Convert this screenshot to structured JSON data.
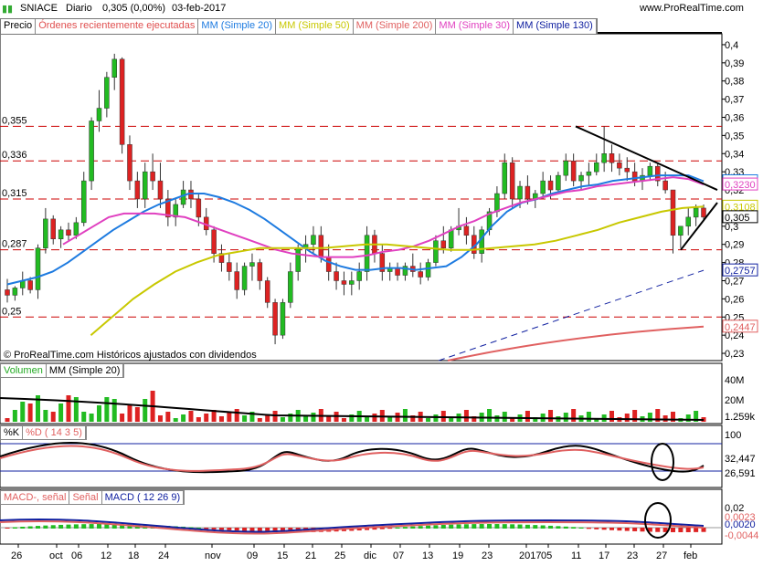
{
  "header": {
    "symbol": "SNIACE",
    "period": "Diario",
    "last": "0,305 (0,00%)",
    "date": "03-feb-2017",
    "site": "www.ProRealTime.com"
  },
  "legend": [
    {
      "label": "Precio",
      "color": "#000000"
    },
    {
      "label": "Órdenes recientemente ejecutadas",
      "color": "#e05050"
    },
    {
      "label": "MM (Simple 20)",
      "color": "#1e7be0"
    },
    {
      "label": "MM (Simple 50)",
      "color": "#c8c800"
    },
    {
      "label": "MM (Simple 200)",
      "color": "#e06060"
    },
    {
      "label": "MM (Simple 30)",
      "color": "#e040c0"
    },
    {
      "label": "MM (Simple 130)",
      "color": "#1020a0"
    }
  ],
  "copyright": "© ProRealTime.com  Históricos ajustados con dividendos",
  "volume_legend": [
    "Volumen",
    "MM (Simple 20)"
  ],
  "stoch_legend": [
    "%K",
    "%D ( 14 3 5)"
  ],
  "macd_legend": [
    "MACD-, señal",
    "Señal",
    "MACD ( 12 26 9)"
  ],
  "colors": {
    "up": "#22bb22",
    "down": "#dd2222",
    "ma20": "#1e7be0",
    "ma50": "#c8c800",
    "ma200": "#e06060",
    "ma30": "#e040c0",
    "ma130": "#1020a0"
  },
  "chart_data": {
    "type": "candlestick",
    "y_ticks": [
      "0,4",
      "0,39",
      "0,38",
      "0,37",
      "0,36",
      "0,35",
      "0,34",
      "0,33",
      "0,32",
      "0,31",
      "0,3",
      "0,29",
      "0,28",
      "0,27",
      "0,26",
      "0,25",
      "0,24",
      "0,23"
    ],
    "ylim": [
      0.226,
      0.406
    ],
    "levels": [
      {
        "label": "0,355",
        "value": 0.355
      },
      {
        "label": "0,336",
        "value": 0.336
      },
      {
        "label": "0,315",
        "value": 0.315
      },
      {
        "label": "0,287",
        "value": 0.287
      },
      {
        "label": "0,25",
        "value": 0.25
      }
    ],
    "price_boxes": [
      {
        "label": "0,3248",
        "value": 0.3248,
        "color": "#1e7be0"
      },
      {
        "label": "0,3230",
        "value": 0.323,
        "color": "#e040c0"
      },
      {
        "label": "0,3108",
        "value": 0.3108,
        "color": "#c8c800"
      },
      {
        "label": "0,305",
        "value": 0.305,
        "color": "#000000"
      },
      {
        "label": "0,2757",
        "value": 0.2757,
        "color": "#1020a0"
      },
      {
        "label": "0,2447",
        "value": 0.2447,
        "color": "#e06060"
      }
    ],
    "x_ticks": [
      "26",
      "oct",
      "06",
      "12",
      "18",
      "24",
      "nov",
      "09",
      "15",
      "21",
      "25",
      "dic",
      "07",
      "13",
      "19",
      "23",
      "2017",
      "05",
      "11",
      "17",
      "23",
      "27",
      "feb"
    ],
    "candles": [
      [
        0.265,
        0.271,
        0.258,
        0.262
      ],
      [
        0.262,
        0.267,
        0.259,
        0.266
      ],
      [
        0.266,
        0.275,
        0.262,
        0.27
      ],
      [
        0.27,
        0.272,
        0.263,
        0.265
      ],
      [
        0.265,
        0.29,
        0.26,
        0.288
      ],
      [
        0.288,
        0.31,
        0.285,
        0.304
      ],
      [
        0.304,
        0.306,
        0.29,
        0.293
      ],
      [
        0.293,
        0.3,
        0.288,
        0.298
      ],
      [
        0.298,
        0.302,
        0.292,
        0.295
      ],
      [
        0.295,
        0.305,
        0.293,
        0.302
      ],
      [
        0.302,
        0.33,
        0.3,
        0.325
      ],
      [
        0.325,
        0.36,
        0.32,
        0.358
      ],
      [
        0.358,
        0.375,
        0.352,
        0.365
      ],
      [
        0.365,
        0.385,
        0.36,
        0.382
      ],
      [
        0.382,
        0.395,
        0.375,
        0.392
      ],
      [
        0.392,
        0.393,
        0.34,
        0.345
      ],
      [
        0.345,
        0.35,
        0.32,
        0.325
      ],
      [
        0.325,
        0.33,
        0.31,
        0.315
      ],
      [
        0.315,
        0.335,
        0.31,
        0.33
      ],
      [
        0.33,
        0.34,
        0.32,
        0.325
      ],
      [
        0.325,
        0.335,
        0.31,
        0.315
      ],
      [
        0.315,
        0.32,
        0.3,
        0.305
      ],
      [
        0.305,
        0.315,
        0.3,
        0.312
      ],
      [
        0.312,
        0.325,
        0.31,
        0.32
      ],
      [
        0.32,
        0.325,
        0.31,
        0.315
      ],
      [
        0.315,
        0.318,
        0.3,
        0.305
      ],
      [
        0.305,
        0.31,
        0.295,
        0.298
      ],
      [
        0.298,
        0.3,
        0.28,
        0.285
      ],
      [
        0.285,
        0.29,
        0.275,
        0.28
      ],
      [
        0.28,
        0.285,
        0.27,
        0.275
      ],
      [
        0.275,
        0.28,
        0.26,
        0.265
      ],
      [
        0.265,
        0.28,
        0.262,
        0.278
      ],
      [
        0.278,
        0.285,
        0.27,
        0.28
      ],
      [
        0.28,
        0.282,
        0.265,
        0.27
      ],
      [
        0.27,
        0.272,
        0.255,
        0.258
      ],
      [
        0.258,
        0.26,
        0.235,
        0.24
      ],
      [
        0.24,
        0.26,
        0.238,
        0.258
      ],
      [
        0.258,
        0.28,
        0.255,
        0.275
      ],
      [
        0.275,
        0.29,
        0.27,
        0.288
      ],
      [
        0.288,
        0.295,
        0.28,
        0.29
      ],
      [
        0.29,
        0.3,
        0.285,
        0.295
      ],
      [
        0.295,
        0.3,
        0.28,
        0.283
      ],
      [
        0.283,
        0.29,
        0.27,
        0.275
      ],
      [
        0.275,
        0.28,
        0.265,
        0.27
      ],
      [
        0.27,
        0.275,
        0.262,
        0.268
      ],
      [
        0.268,
        0.275,
        0.262,
        0.27
      ],
      [
        0.27,
        0.28,
        0.265,
        0.275
      ],
      [
        0.275,
        0.3,
        0.27,
        0.295
      ],
      [
        0.295,
        0.298,
        0.28,
        0.285
      ],
      [
        0.285,
        0.29,
        0.27,
        0.275
      ],
      [
        0.275,
        0.28,
        0.27,
        0.277
      ],
      [
        0.277,
        0.28,
        0.27,
        0.273
      ],
      [
        0.273,
        0.28,
        0.27,
        0.278
      ],
      [
        0.278,
        0.285,
        0.272,
        0.275
      ],
      [
        0.275,
        0.28,
        0.268,
        0.272
      ],
      [
        0.272,
        0.282,
        0.27,
        0.28
      ],
      [
        0.28,
        0.295,
        0.278,
        0.292
      ],
      [
        0.292,
        0.3,
        0.285,
        0.288
      ],
      [
        0.288,
        0.3,
        0.286,
        0.298
      ],
      [
        0.298,
        0.31,
        0.295,
        0.3
      ],
      [
        0.3,
        0.305,
        0.29,
        0.295
      ],
      [
        0.295,
        0.3,
        0.282,
        0.285
      ],
      [
        0.285,
        0.3,
        0.28,
        0.298
      ],
      [
        0.298,
        0.31,
        0.295,
        0.308
      ],
      [
        0.308,
        0.322,
        0.305,
        0.318
      ],
      [
        0.318,
        0.34,
        0.315,
        0.335
      ],
      [
        0.335,
        0.338,
        0.31,
        0.315
      ],
      [
        0.315,
        0.325,
        0.31,
        0.322
      ],
      [
        0.322,
        0.328,
        0.312,
        0.315
      ],
      [
        0.315,
        0.32,
        0.31,
        0.318
      ],
      [
        0.318,
        0.33,
        0.315,
        0.325
      ],
      [
        0.325,
        0.328,
        0.315,
        0.32
      ],
      [
        0.32,
        0.33,
        0.318,
        0.328
      ],
      [
        0.328,
        0.34,
        0.325,
        0.336
      ],
      [
        0.336,
        0.34,
        0.322,
        0.325
      ],
      [
        0.325,
        0.33,
        0.32,
        0.328
      ],
      [
        0.328,
        0.335,
        0.322,
        0.33
      ],
      [
        0.33,
        0.34,
        0.328,
        0.335
      ],
      [
        0.335,
        0.355,
        0.33,
        0.34
      ],
      [
        0.34,
        0.345,
        0.33,
        0.335
      ],
      [
        0.335,
        0.34,
        0.328,
        0.332
      ],
      [
        0.332,
        0.338,
        0.325,
        0.33
      ],
      [
        0.33,
        0.335,
        0.322,
        0.325
      ],
      [
        0.325,
        0.332,
        0.32,
        0.328
      ],
      [
        0.328,
        0.335,
        0.325,
        0.333
      ],
      [
        0.333,
        0.335,
        0.322,
        0.325
      ],
      [
        0.325,
        0.33,
        0.318,
        0.32
      ],
      [
        0.32,
        0.31,
        0.285,
        0.295
      ],
      [
        0.295,
        0.3,
        0.288,
        0.3
      ],
      [
        0.3,
        0.31,
        0.295,
        0.305
      ],
      [
        0.305,
        0.312,
        0.3,
        0.31
      ],
      [
        0.31,
        0.312,
        0.303,
        0.305
      ]
    ],
    "ma20": [
      0.268,
      0.27,
      0.272,
      0.275,
      0.28,
      0.286,
      0.292,
      0.298,
      0.303,
      0.308,
      0.312,
      0.315,
      0.318,
      0.318,
      0.316,
      0.313,
      0.309,
      0.304,
      0.298,
      0.292,
      0.286,
      0.281,
      0.278,
      0.276,
      0.276,
      0.277,
      0.277,
      0.276,
      0.277,
      0.278,
      0.283,
      0.29,
      0.3,
      0.308,
      0.313,
      0.315,
      0.318,
      0.32,
      0.322,
      0.323,
      0.325,
      0.326,
      0.327,
      0.328,
      0.328,
      0.328,
      0.3248
    ],
    "ma30": [
      0.29,
      0.295,
      0.3,
      0.305,
      0.307,
      0.307,
      0.307,
      0.306,
      0.305,
      0.302,
      0.299,
      0.296,
      0.293,
      0.29,
      0.287,
      0.285,
      0.284,
      0.283,
      0.283,
      0.283,
      0.284,
      0.286,
      0.287,
      0.289,
      0.292,
      0.296,
      0.3,
      0.303,
      0.307,
      0.31,
      0.313,
      0.315,
      0.317,
      0.319,
      0.32,
      0.322,
      0.323,
      0.324,
      0.325,
      0.326,
      0.327,
      0.326,
      0.323
    ],
    "ma50": [
      0.24,
      0.25,
      0.26,
      0.268,
      0.275,
      0.28,
      0.284,
      0.286,
      0.288,
      0.288,
      0.288,
      0.288,
      0.289,
      0.29,
      0.29,
      0.289,
      0.288,
      0.287,
      0.287,
      0.288,
      0.289,
      0.29,
      0.292,
      0.295,
      0.298,
      0.302,
      0.305,
      0.308,
      0.31,
      0.3108
    ],
    "ma130_line": [
      [
        0.23,
        0.2757
      ]
    ],
    "ma200_line": [
      [
        0.223,
        0.2447
      ]
    ],
    "volume_ticks": [
      "40M",
      "20M",
      "1.259k"
    ],
    "stoch_ticks": [
      "100",
      "32,447",
      "26,591"
    ],
    "macd_ticks": [
      "0,02",
      "0,0023",
      "0,0020",
      "-0,0044"
    ]
  }
}
